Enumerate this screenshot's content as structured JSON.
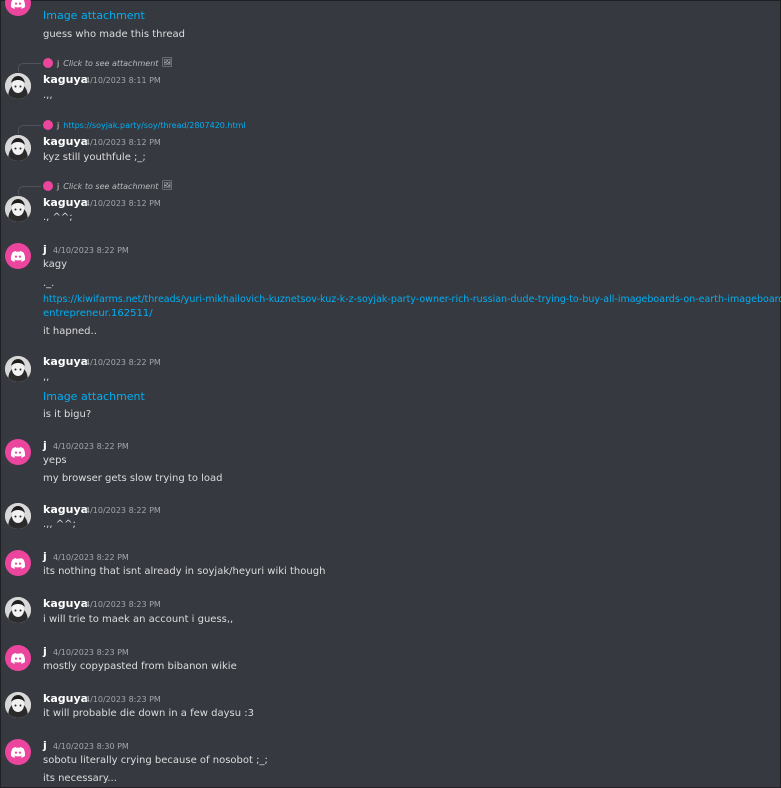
{
  "messages": [
    {
      "attachment": "Image attachment",
      "text": "guess who made this thread"
    },
    {
      "reply": {
        "name": "j",
        "text": "Click to see attachment",
        "icon": "image-icon"
      },
      "author": "kaguya",
      "time": "4/10/2023 8:11 PM",
      "text": ".,,"
    },
    {
      "reply": {
        "name": "j",
        "link": "https://soyjak.party/soy/thread/2807420.html"
      },
      "author": "kaguya",
      "time": "4/10/2023 8:12 PM",
      "text": "kyz still youthfule ;_;"
    },
    {
      "reply": {
        "name": "j",
        "text": "Click to see attachment",
        "icon": "image-icon"
      },
      "author": "kaguya",
      "time": "4/10/2023 8:12 PM",
      "text": "., ^^;"
    },
    {
      "author": "j",
      "time": "4/10/2023 8:22 PM",
      "text": "kagy",
      "text2": "._.",
      "link_line1": "https://kiwifarms.net/threads/yuri-mikhailovich-kuznetsov-kuz-k-z-soyjak-party-owner-rich-russian-dude-trying-to-buy-all-imageboards-on-earth-imageboard-",
      "link_line2": "entrepreneur.162511/",
      "text3": "it hapned.."
    },
    {
      "author": "kaguya",
      "time": "4/10/2023 8:22 PM",
      "text": ",,",
      "attachment": "Image attachment",
      "text2": "is it bigu?"
    },
    {
      "author": "j",
      "time": "4/10/2023 8:22 PM",
      "text": "yeps",
      "text2": "my browser gets slow trying to load"
    },
    {
      "author": "kaguya",
      "time": "4/10/2023 8:22 PM",
      "text": ".,, ^^;"
    },
    {
      "author": "j",
      "time": "4/10/2023 8:22 PM",
      "text": "its nothing that isnt already in soyjak/heyuri wiki though"
    },
    {
      "author": "kaguya",
      "time": "4/10/2023 8:23 PM",
      "text": "i will trie to maek an account i guess,,"
    },
    {
      "author": "j",
      "time": "4/10/2023 8:23 PM",
      "text": "mostly copypasted from bibanon wikie"
    },
    {
      "author": "kaguya",
      "time": "4/10/2023 8:23 PM",
      "text": "it will probable die down in a few daysu :3"
    },
    {
      "author": "j",
      "time": "4/10/2023 8:30 PM",
      "text": "sobotu literally crying because of nosobot ;_;",
      "text2": "its necessary..."
    }
  ],
  "colors": {
    "background": "#36393f",
    "link": "#00aff4",
    "discord_avatar": "#eb459e",
    "username": "#ffffff",
    "timestamp": "#a3a6aa"
  }
}
